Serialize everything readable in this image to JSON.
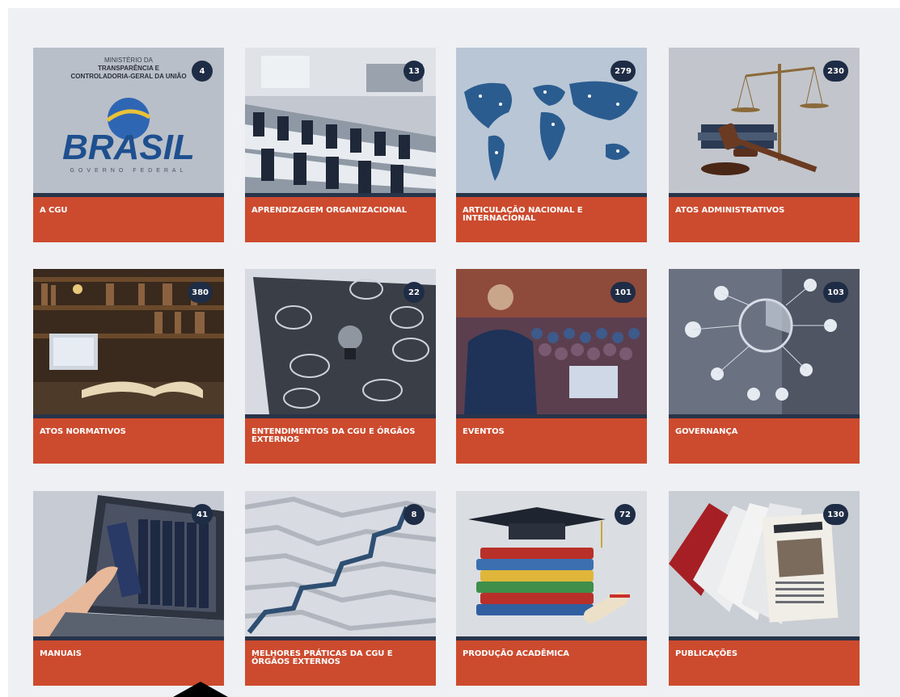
{
  "colors": {
    "background": "#eef0f4",
    "label_bg": "#cc4a2e",
    "strip": "#273449",
    "badge_bg": "#1f2c45",
    "badge_text": "#ffffff"
  },
  "cards": [
    {
      "label": "A CGU",
      "count": "4",
      "icon": "cgu-logo-image",
      "logo": {
        "line1": "MINISTÉRIO DA",
        "line2": "TRANSPARÊNCIA E",
        "line3": "CONTROLADORIA-GERAL DA UNIÃO",
        "brand": "BRASIL",
        "sub": "GOVERNO FEDERAL"
      }
    },
    {
      "label": "APRENDIZAGEM ORGANIZACIONAL",
      "count": "13",
      "icon": "classroom-image"
    },
    {
      "label": "ARTICULAÇÃO NACIONAL E INTERNACIONAL",
      "count": "279",
      "icon": "world-map-image"
    },
    {
      "label": "ATOS ADMINISTRATIVOS",
      "count": "230",
      "icon": "justice-scale-image"
    },
    {
      "label": "ATOS NORMATIVOS",
      "count": "380",
      "icon": "library-book-image"
    },
    {
      "label": "ENTENDIMENTOS DA CGU E ÓRGÃOS EXTERNOS",
      "count": "22",
      "icon": "lightbulb-chalkboard-image"
    },
    {
      "label": "EVENTOS",
      "count": "101",
      "icon": "conference-speaker-image"
    },
    {
      "label": "GOVERNANÇA",
      "count": "103",
      "icon": "network-chart-image"
    },
    {
      "label": "MANUAIS",
      "count": "41",
      "icon": "laptop-books-image"
    },
    {
      "label": "MELHORES PRÁTICAS DA CGU E ÓRGÃOS EXTERNOS",
      "count": "8",
      "icon": "maze-image"
    },
    {
      "label": "PRODUÇÃO ACADÊMICA",
      "count": "72",
      "icon": "graduation-books-image"
    },
    {
      "label": "PUBLICAÇÕES",
      "count": "130",
      "icon": "newspapers-image"
    }
  ]
}
